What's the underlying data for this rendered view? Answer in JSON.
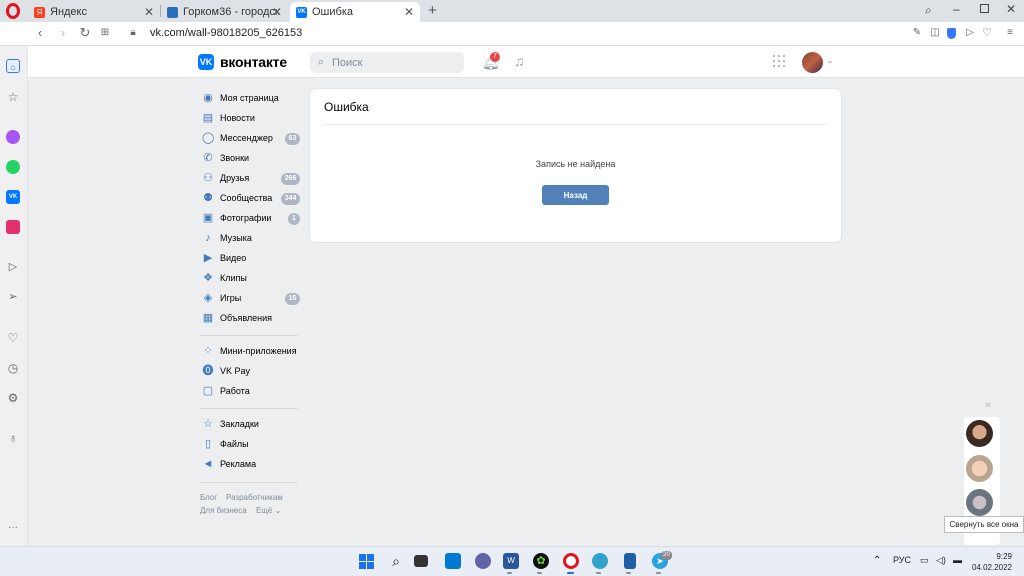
{
  "browser": {
    "tabs": [
      {
        "label": "Яндекс",
        "favicon_color": "#fc3f1d",
        "favicon_letter": "Я",
        "active": false
      },
      {
        "label": "Горком36 - городской по",
        "favicon_color": "#2a6ebb",
        "favicon_letter": "",
        "active": false
      },
      {
        "label": "Ошибка",
        "favicon_color": "#0077ff",
        "favicon_letter": "VK",
        "active": true
      }
    ],
    "new_tab": "+",
    "url": "vk.com/wall-98018205_626153"
  },
  "vk": {
    "brand": "вконтакте",
    "logo": "VK",
    "search": {
      "placeholder": "Поиск",
      "value": ""
    },
    "notifications_count": "7",
    "menu": [
      {
        "label": "Моя страница",
        "icon": "user-circle-icon",
        "count": ""
      },
      {
        "label": "Новости",
        "icon": "news-icon",
        "count": ""
      },
      {
        "label": "Мессенджер",
        "icon": "message-icon",
        "count": "63"
      },
      {
        "label": "Звонки",
        "icon": "phone-icon",
        "count": ""
      },
      {
        "label": "Друзья",
        "icon": "friends-icon",
        "count": "266"
      },
      {
        "label": "Сообщества",
        "icon": "communities-icon",
        "count": "344"
      },
      {
        "label": "Фотографии",
        "icon": "photo-icon",
        "count": "1"
      },
      {
        "label": "Музыка",
        "icon": "music-icon",
        "count": ""
      },
      {
        "label": "Видео",
        "icon": "video-icon",
        "count": ""
      },
      {
        "label": "Клипы",
        "icon": "clips-icon",
        "count": ""
      },
      {
        "label": "Игры",
        "icon": "games-icon",
        "count": "15"
      },
      {
        "label": "Объявления",
        "icon": "ads-board-icon",
        "count": ""
      }
    ],
    "menu2": [
      {
        "label": "Мини-приложения",
        "icon": "mini-apps-icon"
      },
      {
        "label": "VK Pay",
        "icon": "vk-pay-icon"
      },
      {
        "label": "Работа",
        "icon": "briefcase-icon"
      }
    ],
    "menu3": [
      {
        "label": "Закладки",
        "icon": "star-icon"
      },
      {
        "label": "Файлы",
        "icon": "file-icon"
      },
      {
        "label": "Реклама",
        "icon": "megaphone-icon"
      }
    ],
    "footer": {
      "blog": "Блог",
      "developers": "Разработчикам",
      "business": "Для бизнеса",
      "more": "Ещё"
    },
    "error_card": {
      "title": "Ошибка",
      "message": "Запись не найдена",
      "back_button": "Назад"
    },
    "collapse_label": "«",
    "tooltip": "Свернуть все окна"
  },
  "taskbar": {
    "language": "РУС",
    "time": "9:29",
    "date": "04.02.2022",
    "telegram_badge": "20"
  },
  "colors": {
    "vk_blue": "#0077ff",
    "button_blue": "#5181b8",
    "page_bg": "#edeef0"
  }
}
